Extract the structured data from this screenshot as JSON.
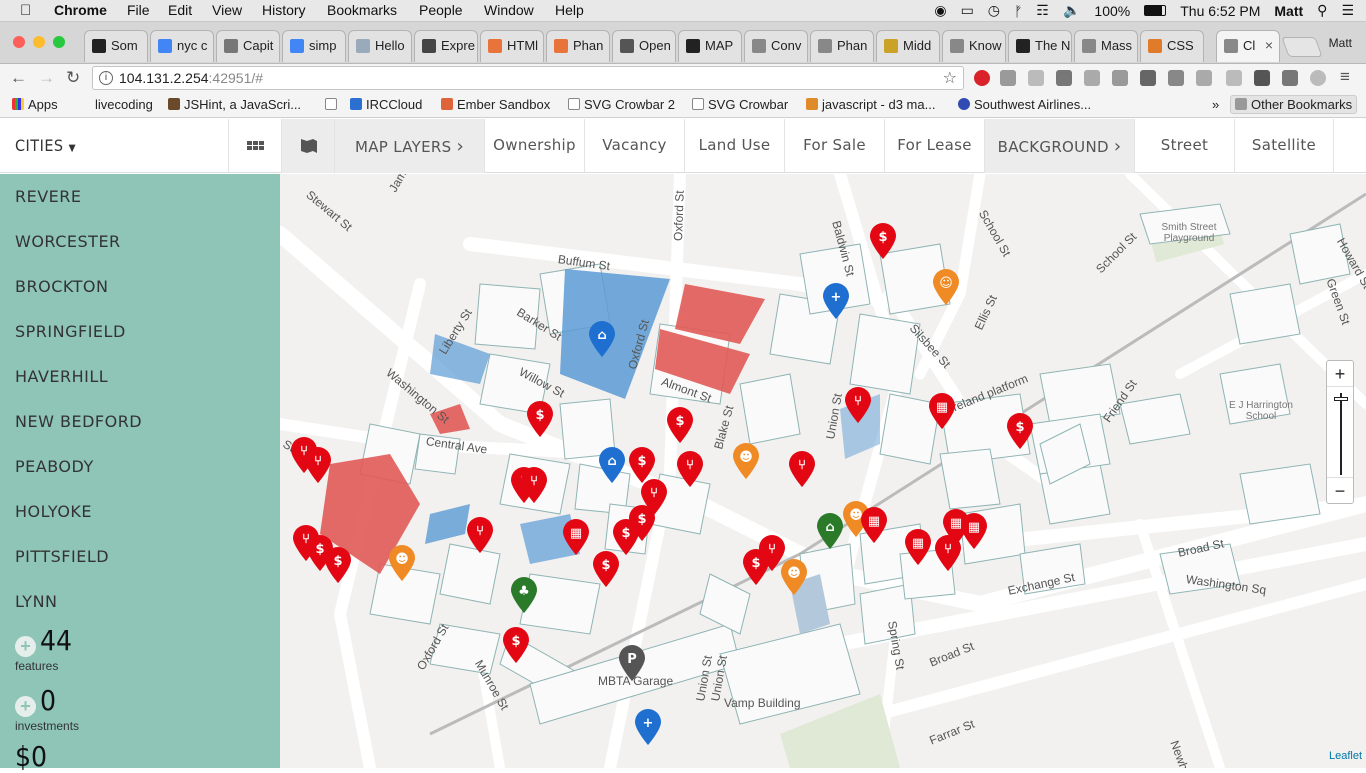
{
  "menubar": {
    "app": "Chrome",
    "items": [
      "File",
      "Edit",
      "View",
      "History",
      "Bookmarks",
      "People",
      "Window",
      "Help"
    ],
    "battery": "100%",
    "clock": "Thu 6:52 PM",
    "user": "Matt"
  },
  "tabs": [
    {
      "label": "Som",
      "color": "#222"
    },
    {
      "label": "nyc c",
      "color": "#4285f4"
    },
    {
      "label": "Capit",
      "color": "#777"
    },
    {
      "label": "simp",
      "color": "#4285f4"
    },
    {
      "label": "Hello",
      "color": "#9ab"
    },
    {
      "label": "Expre",
      "color": "#444"
    },
    {
      "label": "HTMl",
      "color": "#e8743b"
    },
    {
      "label": "Phan",
      "color": "#e8743b"
    },
    {
      "label": "Open",
      "color": "#555"
    },
    {
      "label": "MAP",
      "color": "#222"
    },
    {
      "label": "Conv",
      "color": "#888"
    },
    {
      "label": "Phan",
      "color": "#888"
    },
    {
      "label": "Midd",
      "color": "#c9a227"
    },
    {
      "label": "Know",
      "color": "#888"
    },
    {
      "label": "The N",
      "color": "#222"
    },
    {
      "label": "Mass",
      "color": "#888"
    },
    {
      "label": "CSS",
      "color": "#e07b2a"
    },
    {
      "label": "Cl",
      "color": "#888"
    }
  ],
  "profile": "Matt",
  "address": {
    "host": "104.131.2.254",
    "rest": ":42951/#"
  },
  "bookmarks": {
    "items": [
      "Apps",
      "livecoding",
      "JSHint, a JavaScri...",
      "IRCCloud",
      "Ember Sandbox",
      "SVG Crowbar 2",
      "SVG Crowbar",
      "javascript - d3 ma...",
      "Southwest Airlines..."
    ],
    "overflow": "»",
    "other": "Other Bookmarks"
  },
  "app": {
    "cities_label": "CITIES",
    "map_layers": "MAP LAYERS",
    "layers": [
      "Ownership",
      "Vacancy",
      "Land Use",
      "For Sale",
      "For Lease"
    ],
    "background": "BACKGROUND",
    "bg_options": [
      "Street",
      "Satellite"
    ]
  },
  "cities": [
    "REVERE",
    "WORCESTER",
    "BROCKTON",
    "SPRINGFIELD",
    "HAVERHILL",
    "NEW BEDFORD",
    "PEABODY",
    "HOLYOKE",
    "PITTSFIELD",
    "LYNN"
  ],
  "stats": {
    "features": {
      "value": "44",
      "label": "features"
    },
    "investments": {
      "value": "0",
      "label": "investments"
    },
    "money": {
      "value": "$0"
    }
  },
  "map": {
    "streets": [
      "Stewart St",
      "James St",
      "Oxford St",
      "Buffum St",
      "Barker St",
      "Liberty St",
      "Washington St",
      "Willow St",
      "Oxford St",
      "Almont St",
      "Blake St",
      "Central Ave",
      "Baldwin St",
      "School St",
      "School St",
      "Silsbee St",
      "Ellis St",
      "Union St",
      "Union St",
      "Friend St",
      "Broad St",
      "Washington Sq",
      "Exchange St",
      "Broad St",
      "Farrar St",
      "Spring St",
      "Newhall St",
      "Munroe St",
      "Oxford St",
      "Sutton St",
      "Green St",
      "Howard St",
      "Union St",
      "Smith Street Playground",
      "E J Harrington School",
      "MBTA Garage",
      "Vamp Building",
      "Ireland platform"
    ],
    "zoom_in": "+",
    "zoom_out": "−",
    "attribution": "Leaflet"
  }
}
